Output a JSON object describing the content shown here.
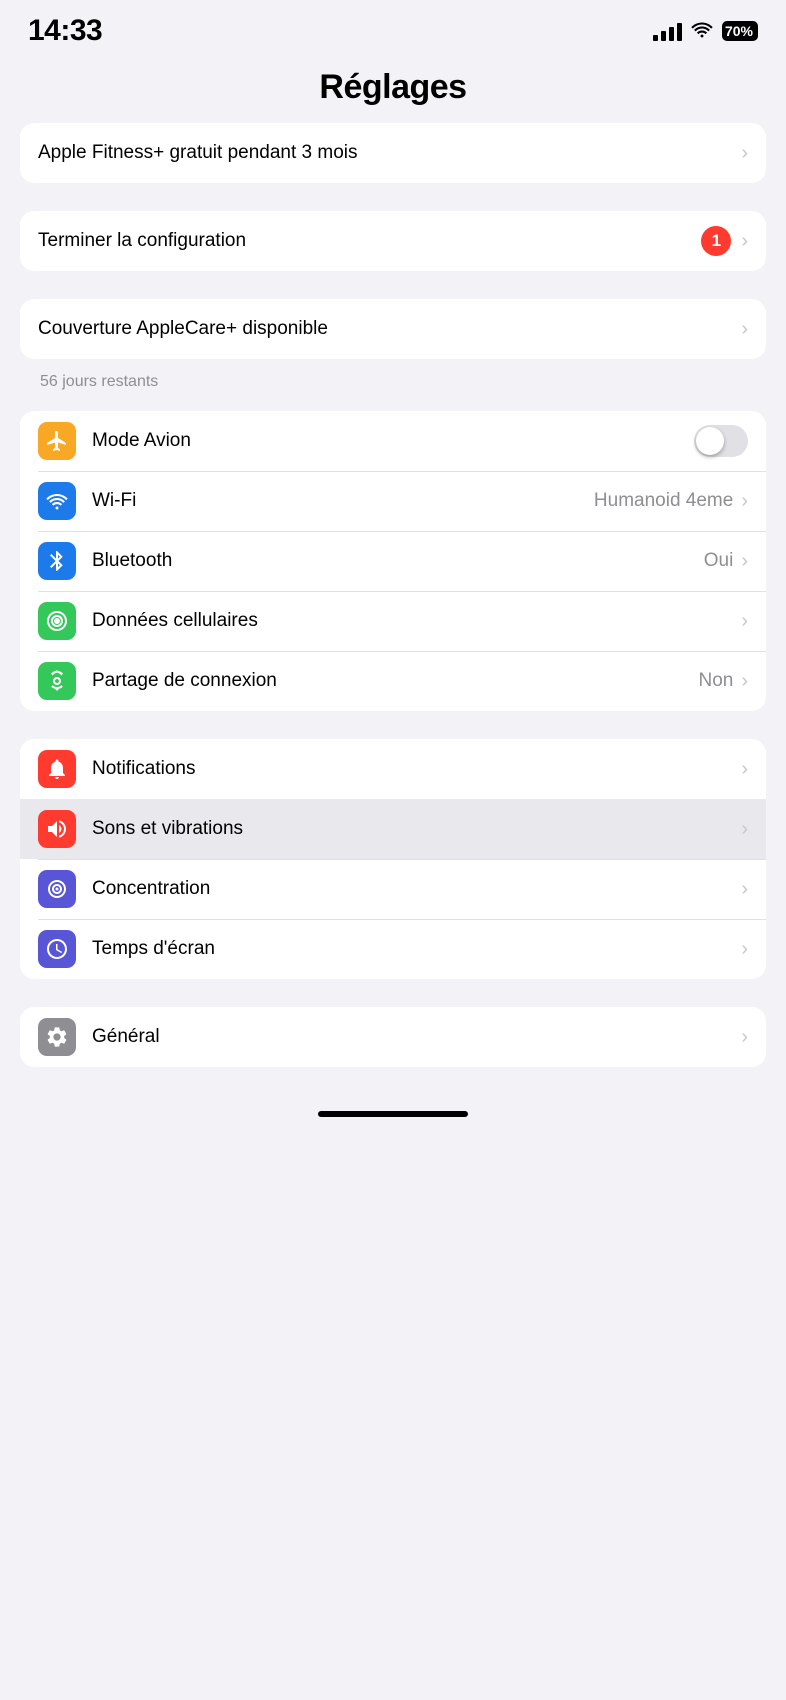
{
  "statusBar": {
    "time": "14:33",
    "battery": "70"
  },
  "header": {
    "title": "Réglages"
  },
  "sections": {
    "fitness": {
      "label": "Apple Fitness+ gratuit pendant 3 mois"
    },
    "setup": {
      "label": "Terminer la configuration",
      "badge": "1"
    },
    "applecare": {
      "label": "Couverture AppleCare+ disponible",
      "subtitle": "56 jours restants"
    },
    "network": [
      {
        "id": "airplane",
        "label": "Mode Avion",
        "value": "",
        "hasToggle": true,
        "iconColor": "#f9a825",
        "iconType": "airplane"
      },
      {
        "id": "wifi",
        "label": "Wi-Fi",
        "value": "Humanoid 4eme",
        "hasToggle": false,
        "iconColor": "#1c7aeb",
        "iconType": "wifi"
      },
      {
        "id": "bluetooth",
        "label": "Bluetooth",
        "value": "Oui",
        "hasToggle": false,
        "iconColor": "#1c7aeb",
        "iconType": "bluetooth"
      },
      {
        "id": "cellular",
        "label": "Données cellulaires",
        "value": "",
        "hasToggle": false,
        "iconColor": "#34c759",
        "iconType": "cellular"
      },
      {
        "id": "hotspot",
        "label": "Partage de connexion",
        "value": "Non",
        "hasToggle": false,
        "iconColor": "#34c759",
        "iconType": "hotspot"
      }
    ],
    "settings": [
      {
        "id": "notifications",
        "label": "Notifications",
        "iconColor": "#ff3b30",
        "iconType": "notifications",
        "highlighted": false
      },
      {
        "id": "sounds",
        "label": "Sons et vibrations",
        "iconColor": "#ff3b30",
        "iconType": "sounds",
        "highlighted": true
      },
      {
        "id": "focus",
        "label": "Concentration",
        "iconColor": "#5856d6",
        "iconType": "focus",
        "highlighted": false
      },
      {
        "id": "screentime",
        "label": "Temps d'écran",
        "iconColor": "#5856d6",
        "iconType": "screentime",
        "highlighted": false
      }
    ],
    "general": [
      {
        "id": "general",
        "label": "Général",
        "iconColor": "#8e8e93",
        "iconType": "general",
        "highlighted": false
      }
    ]
  }
}
